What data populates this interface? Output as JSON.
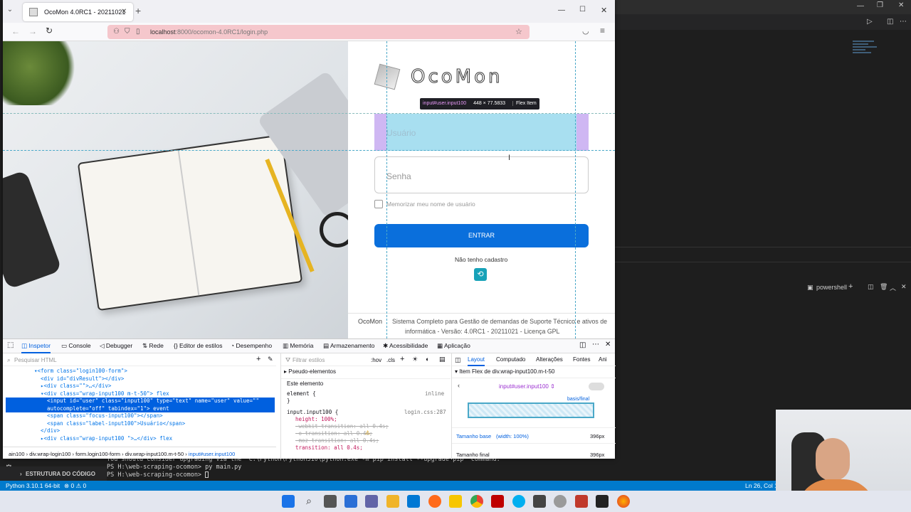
{
  "browser": {
    "tab_title": "OcoMon 4.0RC1 - 20211021",
    "url_host": "localhost",
    "url_rest": ":8000/ocomon-4.0RC1/login.php"
  },
  "login": {
    "logo_text": "OcoMon",
    "user_placeholder": "Usuário",
    "password_placeholder": "Senha",
    "remember_label": "Memorizar meu nome de usuário",
    "submit_label": "ENTRAR",
    "no_account": "Não tenho cadastro",
    "footer_brand": "OcoMon",
    "footer_text_1": "Sistema Completo para Gestão de demandas de Suporte Técnico e ativos de",
    "footer_text_2": "informática - Versão: 4.0RC1 - 20211021 - Licença GPL"
  },
  "tooltip": {
    "selector": "input#user.input100",
    "size": "448 × 77.5833",
    "badge": "Flex Item"
  },
  "devtools": {
    "tabs": [
      "Inspetor",
      "Console",
      "Debugger",
      "Rede",
      "Editor de estilos",
      "Desempenho",
      "Memória",
      "Armazenamento",
      "Acessibilidade",
      "Aplicação"
    ],
    "search_html": "Pesquisar HTML",
    "html_lines": [
      "▾<form class=\"login100-form\">",
      "  <div id=\"divResult\"></div>",
      "  ▸<div class=\"\">…</div>",
      "  ▾<div class=\"wrap-input100 m-t-50\"> flex",
      "    <input id=\"user\" class=\"input100\" type=\"text\" name=\"user\" value=\"\"",
      "    autocomplete=\"off\" tabindex=\"1\"> event",
      "    <span class=\"focus-input100\"></span>",
      "    <span class=\"label-input100\">Usuário</span>",
      "  </div>",
      "  ▸<div class=\"wrap-input100 \">…</div> flex"
    ],
    "breadcrumb": [
      "ain100",
      "div.wrap-login100",
      "form.login100-form",
      "div.wrap-input100.m-t-50",
      "input#user.input100"
    ],
    "filter_styles": "Filtrar estilos",
    "hov": ":hov",
    "cls": ".cls",
    "pseudo": "Pseudo-elementos",
    "this_element": "Este elemento",
    "element_rule": "element {",
    "inline": "inline",
    "rule_selector": "input.input100 {",
    "rule_source": "login.css:287",
    "rule_props": [
      "height: 100%;",
      "-webkit-transition: all 0.4s;",
      "-o-transition: all 0.4s;",
      "-moz-transition: all 0.4s;",
      "transition: all 0.4s;"
    ],
    "layout_tabs": [
      "Layout",
      "Computado",
      "Alterações",
      "Fontes",
      "Ani"
    ],
    "flex_item_title": "Item Flex de div.wrap-input100.m-t-50",
    "flex_selector": "input#user.input100",
    "basis_label": "basis/final",
    "base_size_label": "Tamanho base",
    "base_size_detail": "(width: 100%)",
    "base_size_value": "396px",
    "final_size_label": "Tamanho final",
    "final_size_value": "396px"
  },
  "vscode": {
    "terminal_label": "powershell",
    "terminal_lines": [
      "You should consider upgrading via the 'C:\\Python\\Python310\\python.exe -m pip install --upgrade pip' command.",
      "PS H:\\web-scraping-ocomon> py main.py",
      "PS H:\\web-scraping-ocomon> "
    ],
    "outline_label": "ESTRUTURA DO CÓDIGO",
    "python_version": "Python 3.10.1 64-bit",
    "problems": "⊗ 0 ⚠ 0",
    "cursor_pos": "Ln 26, Col 1"
  }
}
